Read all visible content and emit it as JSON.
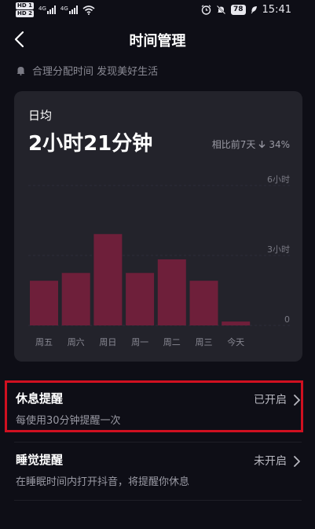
{
  "status_bar": {
    "sim1": "HD 1",
    "sim2": "HD 2",
    "net1": "4G",
    "net2": "4G",
    "battery": "78",
    "time": "15:41",
    "icons": [
      "alarm-icon",
      "mute-icon",
      "battery-icon",
      "leaf-icon"
    ]
  },
  "nav": {
    "title": "时间管理",
    "back_icon": "chevron-left-icon"
  },
  "tip": {
    "icon": "bell-icon",
    "text": "合理分配时间 发现美好生活"
  },
  "stats": {
    "avg_label": "日均",
    "avg_value": "2小时21分钟",
    "compare_label": "相比前7天",
    "compare_icon": "arrow-down-icon",
    "compare_value": "34%"
  },
  "chart_data": {
    "type": "bar",
    "categories": [
      "周五",
      "周六",
      "周日",
      "周一",
      "周二",
      "周三",
      "今天"
    ],
    "values": [
      115,
      135,
      235,
      135,
      170,
      115,
      10
    ],
    "unit": "minutes",
    "ylim": [
      0,
      360
    ],
    "yticks": [
      {
        "value": 360,
        "label": "6小时"
      },
      {
        "value": 180,
        "label": "3小时"
      },
      {
        "value": 0,
        "label": "0"
      }
    ],
    "bar_color": "#6e1f3a",
    "grid": true
  },
  "settings": [
    {
      "title": "休息提醒",
      "desc": "每使用30分钟提醒一次",
      "status": "已开启",
      "highlighted": true
    },
    {
      "title": "睡觉提醒",
      "desc": "在睡眠时间内打开抖音，将提醒你休息",
      "status": "未开启",
      "highlighted": false
    }
  ],
  "colors": {
    "background": "#0e0e16",
    "card": "#23232b",
    "highlight": "#d01020"
  }
}
